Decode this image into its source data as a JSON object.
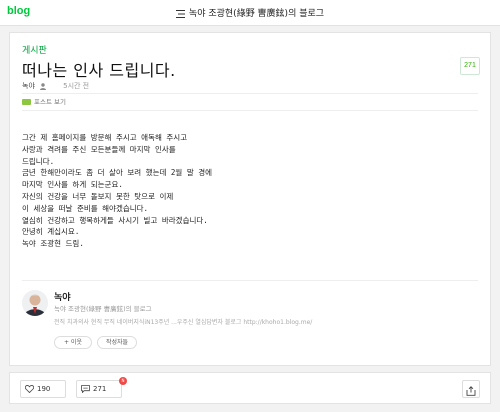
{
  "header": {
    "logo": "blog",
    "blog_title": "녹야 조광현(綠野 曺廣鉉)의 블로그"
  },
  "post": {
    "category": "게시판",
    "title": "떠나는 인사 드립니다.",
    "comment_count_badge": "271",
    "author": "녹야",
    "time_ago": "5시간 전",
    "post_view_label": "포스트 보기",
    "body_lines": [
      "그간 제 홈페이지를 방문해 주시고 애독해 주시고",
      "사랑과 격려를 주신 모든분들께 마지막 인사를",
      "드립니다.",
      "금년 한해만이라도 좀 더 살아 보려 했는데 2월 말 경에",
      "마지막 인사를 하게 되는군요.",
      "자신의 건강을 너무 돌보지 못한 탓으로 이제",
      "이 세상을 떠날 준비를 해야겠습니다.",
      "열심히 건강하고 행복하게들 사시기 빌고 바라겠습니다.",
      "안녕히 계십시요.",
      "",
      "녹야 조광현 드림."
    ]
  },
  "profile": {
    "name": "녹야",
    "subtitle": "녹야 조광현(綠野 曺廣鉉)의 블로그",
    "description": "전직 치과의사 현직 무직 네이버지식iN13주년 ...우주신 열심답변자 블로그 http://khoho1.blog.me/",
    "neighbor_button": "+ 이웃",
    "posts_button": "작성자들"
  },
  "footer": {
    "likes": "190",
    "comments": "271",
    "comment_badge": "N"
  },
  "colors": {
    "brand_green": "#00c73c",
    "category_green": "#00a33c",
    "badge_red": "#f04a48"
  },
  "icons": [
    "list-icon",
    "person-icon",
    "post-view-icon",
    "heart-icon",
    "comment-icon",
    "share-icon"
  ]
}
